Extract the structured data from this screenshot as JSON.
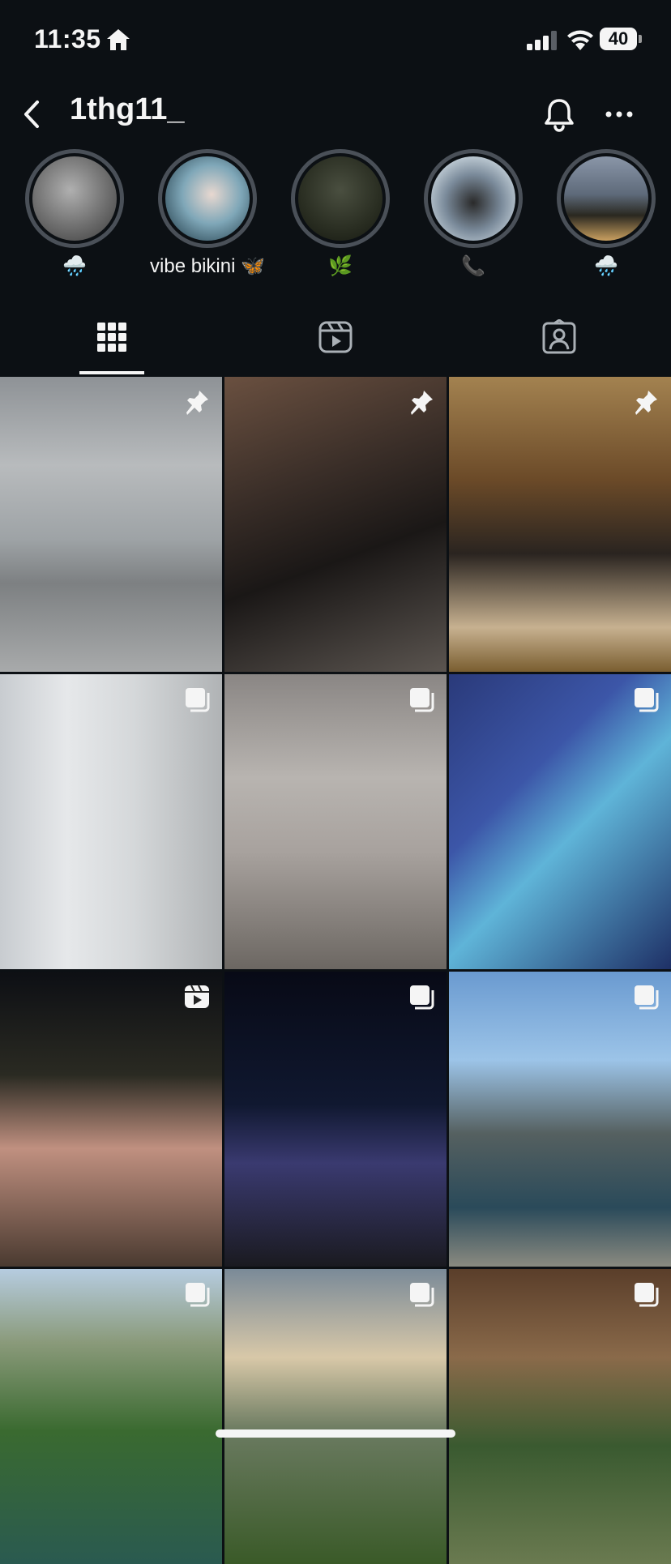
{
  "status_bar": {
    "time": "11:35",
    "battery": "40",
    "icons": [
      "home-icon",
      "signal-icon",
      "wifi-icon",
      "battery-icon"
    ]
  },
  "header": {
    "username": "1thg11_",
    "icons": [
      "back-icon",
      "bell-icon",
      "more-icon"
    ]
  },
  "highlights": [
    {
      "label": "🌧️"
    },
    {
      "label": "vibe bikini 🦋"
    },
    {
      "label": "🌿"
    },
    {
      "label": "📞"
    },
    {
      "label": "🌧️"
    }
  ],
  "tabs": [
    {
      "name": "posts",
      "icon": "grid-icon",
      "active": true
    },
    {
      "name": "reels",
      "icon": "reels-icon",
      "active": false
    },
    {
      "name": "tagged",
      "icon": "tagged-icon",
      "active": false
    }
  ],
  "posts": [
    {
      "badge": "pin-icon"
    },
    {
      "badge": "pin-icon"
    },
    {
      "badge": "pin-icon"
    },
    {
      "badge": "carousel-icon"
    },
    {
      "badge": "carousel-icon"
    },
    {
      "badge": "carousel-icon"
    },
    {
      "badge": "reel-icon"
    },
    {
      "badge": "carousel-icon"
    },
    {
      "badge": "carousel-icon"
    },
    {
      "badge": "carousel-icon"
    },
    {
      "badge": "carousel-icon"
    },
    {
      "badge": "carousel-icon"
    }
  ],
  "colors": {
    "background": "#0c1014",
    "text": "#f5f5f5",
    "ring": "#4a5058"
  }
}
